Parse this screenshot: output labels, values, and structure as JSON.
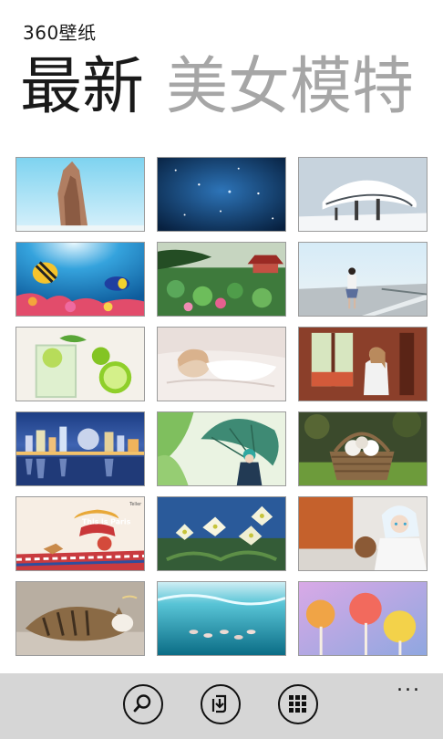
{
  "app": {
    "title": "360壁纸"
  },
  "pivot": {
    "active": "最新",
    "next": "美女模特"
  },
  "appbar": {
    "buttons": [
      {
        "name": "search-icon"
      },
      {
        "name": "import-icon"
      },
      {
        "name": "grid-icon"
      }
    ],
    "more_label": "..."
  },
  "tiles": [
    {
      "name": "rock-pillar-wallpaper"
    },
    {
      "name": "starry-blue-sky-wallpaper"
    },
    {
      "name": "snowy-pine-tree-wallpaper"
    },
    {
      "name": "tropical-fish-reef-wallpaper"
    },
    {
      "name": "lotus-pond-pavilion-wallpaper"
    },
    {
      "name": "girl-on-seaside-road-wallpaper"
    },
    {
      "name": "lime-soda-drink-wallpaper"
    },
    {
      "name": "sleeping-girl-bed-wallpaper"
    },
    {
      "name": "girl-at-window-wallpaper"
    },
    {
      "name": "city-skyline-night-wallpaper"
    },
    {
      "name": "girl-with-umbrella-wallpaper"
    },
    {
      "name": "puppies-in-basket-wallpaper"
    },
    {
      "name": "this-is-paris-illustration-wallpaper",
      "text": "This is Paris"
    },
    {
      "name": "white-flowers-wallpaper"
    },
    {
      "name": "cosplay-girl-wallpaper"
    },
    {
      "name": "sleeping-cat-wallpaper"
    },
    {
      "name": "underwater-fish-wallpaper"
    },
    {
      "name": "colorful-lollipops-wallpaper"
    }
  ]
}
